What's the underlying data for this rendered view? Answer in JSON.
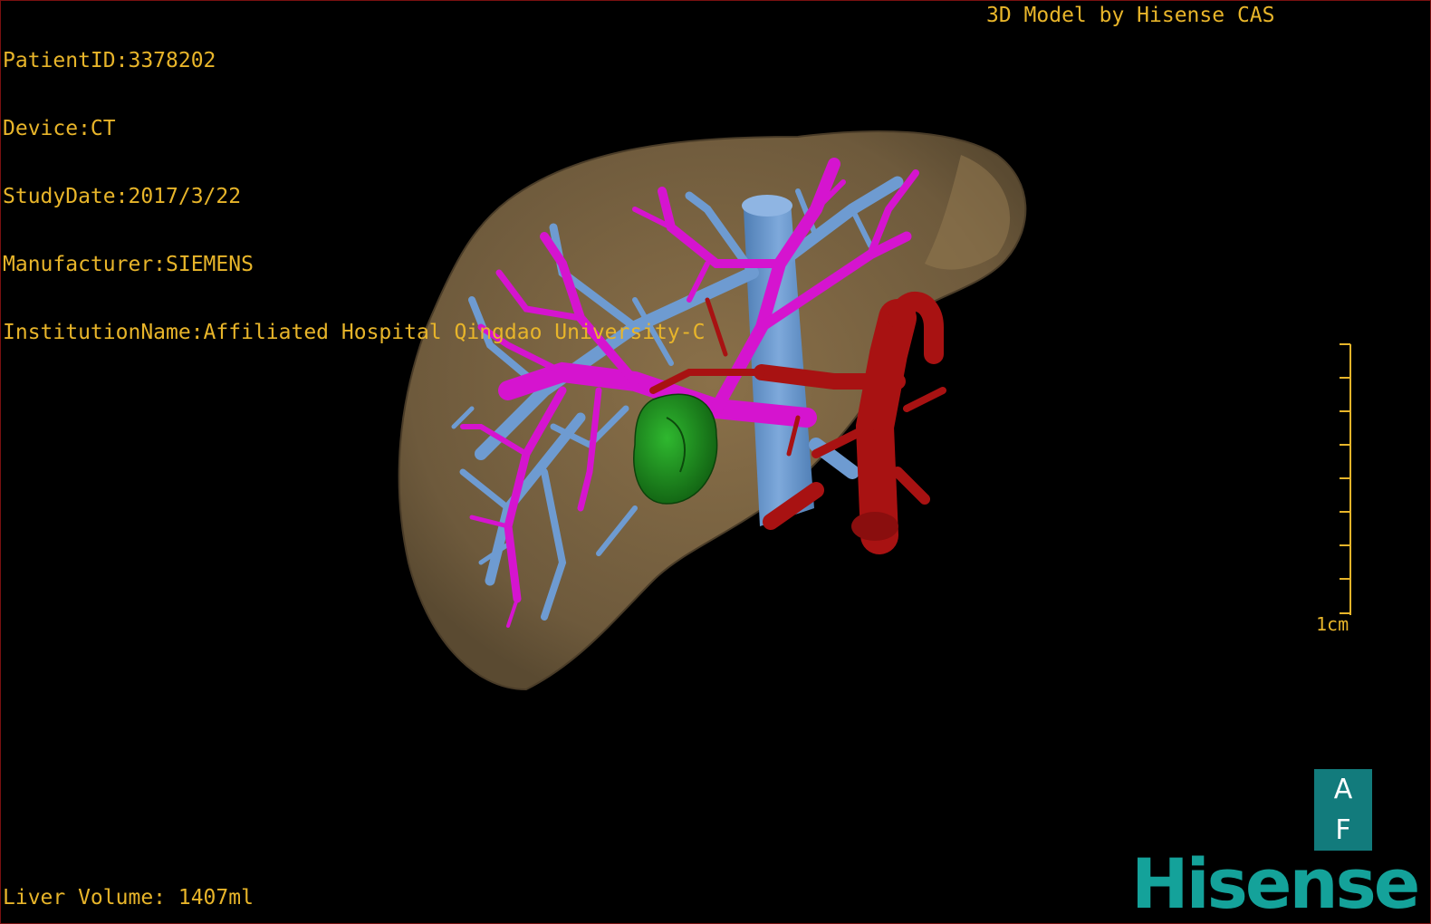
{
  "study_info": [
    "PatientID:3378202",
    "Device:CT",
    "StudyDate:2017/3/22",
    "Manufacturer:SIEMENS",
    "InstitutionName:Affiliated Hospital Qingdao University-C"
  ],
  "header_right": "3D Model by Hisense CAS",
  "volume": "Liver Volume: 1407ml",
  "scale": {
    "label": "1cm"
  },
  "orientation": {
    "top": "A",
    "bottom": "F"
  },
  "logo": "Hisense",
  "colors": {
    "text": "#e8b52a",
    "liver": "#7d6540",
    "portal_vein": "#d514cf",
    "hepatic_vein": "#6e9bd1",
    "artery": "#a81212",
    "tumor": "#1d8a1d",
    "brand": "#14a29a"
  }
}
